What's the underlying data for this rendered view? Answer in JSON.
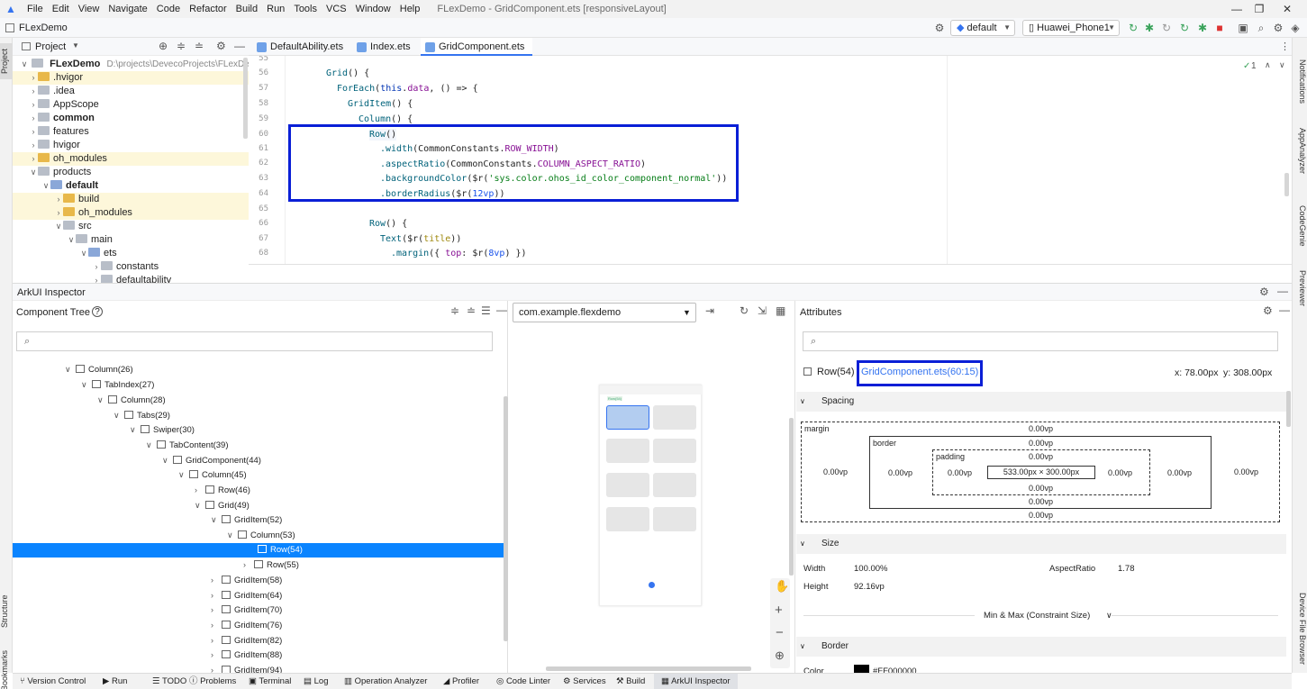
{
  "window": {
    "title": "FLexDemo - GridComponent.ets [responsiveLayout]",
    "menu": [
      "File",
      "Edit",
      "View",
      "Navigate",
      "Code",
      "Refactor",
      "Build",
      "Run",
      "Tools",
      "VCS",
      "Window",
      "Help"
    ]
  },
  "toolbar": {
    "project_name": "FLexDemo",
    "config": "default",
    "device": "Huawei_Phone1"
  },
  "left_strip": {
    "project_tab": "Project",
    "structure_tab": "Structure",
    "bookmarks_tab": "Bookmarks"
  },
  "right_strip": {
    "notifications": "Notifications",
    "app_analyzer": "AppAnalyzer",
    "code_genie": "CodeGenie",
    "previewer": "Previewer",
    "device_file_browser": "Device File Browser"
  },
  "project_panel": {
    "title": "Project",
    "root": "FLexDemo",
    "root_path": "D:\\projects\\DevecoProjects\\FLexDemo",
    "items": [
      ".hvigor",
      ".idea",
      "AppScope",
      "common",
      "features",
      "hvigor",
      "oh_modules",
      "products",
      "default",
      "build",
      "oh_modules",
      "src",
      "main",
      "ets",
      "constants",
      "defaultability"
    ]
  },
  "editor": {
    "tabs": [
      "DefaultAbility.ets",
      "Index.ets",
      "GridComponent.ets"
    ],
    "inspection_count": "1",
    "line_numbers": [
      "55",
      "56",
      "57",
      "58",
      "59",
      "60",
      "61",
      "62",
      "63",
      "64",
      "65",
      "66",
      "67",
      "68"
    ],
    "lines": {
      "l56_kw": "Grid",
      "l56_rest": "() {",
      "l57_kw": "ForEach",
      "l57_a": "(",
      "l57_this": "this",
      "l57_b": ".",
      "l57_data": "data",
      "l57_c": ", () => {",
      "l58_kw": "GridItem",
      "l58_rest": "() {",
      "l59_kw": "Column",
      "l59_rest": "() {",
      "l60_kw": "Row",
      "l60_rest": "()",
      "l61_fn": ".width",
      "l61_a": "(CommonConstants.",
      "l61_c": "ROW_WIDTH",
      "l61_b": ")",
      "l62_fn": ".aspectRatio",
      "l62_a": "(CommonConstants.",
      "l62_c": "COLUMN_ASPECT_RATIO",
      "l62_b": ")",
      "l63_fn": ".backgroundColor",
      "l63_a": "($r(",
      "l63_s": "'sys.color.ohos_id_color_component_normal'",
      "l63_b": "))",
      "l64_fn": ".borderRadius",
      "l64_a": "($r(",
      "l64_n": "12vp",
      "l64_b": "))",
      "l66_kw": "Row",
      "l66_rest": "() {",
      "l67_kw": "Text",
      "l67_a": "($r(",
      "l67_t": "title",
      "l67_b": "))",
      "l68_fn": ".margin",
      "l68_a": "({ ",
      "l68_k": "top",
      "l68_b": ": $r(",
      "l68_n": "8vp",
      "l68_c": ") })"
    }
  },
  "inspector": {
    "title": "ArkUI Inspector",
    "component_tree_title": "Component Tree",
    "app_select": "com.example.flexdemo",
    "tree": [
      {
        "label": "Column(26)",
        "open": true
      },
      {
        "label": "TabIndex(27)",
        "open": true
      },
      {
        "label": "Column(28)",
        "open": true
      },
      {
        "label": "Tabs(29)",
        "open": true
      },
      {
        "label": "Swiper(30)",
        "open": true
      },
      {
        "label": "TabContent(39)",
        "open": true
      },
      {
        "label": "GridComponent(44)",
        "open": true
      },
      {
        "label": "Column(45)",
        "open": true
      },
      {
        "label": "Row(46)",
        "open": false
      },
      {
        "label": "Grid(49)",
        "open": true
      },
      {
        "label": "GridItem(52)",
        "open": true
      },
      {
        "label": "Column(53)",
        "open": true
      },
      {
        "label": "Row(54)",
        "open": false
      },
      {
        "label": "Row(55)",
        "open": false
      },
      {
        "label": "GridItem(58)",
        "open": false
      },
      {
        "label": "GridItem(64)",
        "open": false
      },
      {
        "label": "GridItem(70)",
        "open": false
      },
      {
        "label": "GridItem(76)",
        "open": false
      },
      {
        "label": "GridItem(82)",
        "open": false
      },
      {
        "label": "GridItem(88)",
        "open": false
      },
      {
        "label": "GridItem(94)",
        "open": false
      }
    ],
    "preview_row_label": "Row(54)",
    "attributes": {
      "title": "Attributes",
      "selected_name": "Row(54)",
      "source_link": "GridComponent.ets(60:15)",
      "x": "x: 78.00px",
      "y": "y: 308.00px",
      "spacing_title": "Spacing",
      "margin_label": "margin",
      "border_label": "border",
      "padding_label": "padding",
      "margin_top": "0.00vp",
      "margin_left": "0.00vp",
      "margin_right": "0.00vp",
      "margin_bottom": "0.00vp",
      "border_top": "0.00vp",
      "border_left": "0.00vp",
      "border_right": "0.00vp",
      "border_bottom": "0.00vp",
      "padding_top": "0.00vp",
      "padding_left": "0.00vp",
      "padding_right": "0.00vp",
      "padding_bottom": "0.00vp",
      "content_size": "533.00px × 300.00px",
      "size_title": "Size",
      "width_label": "Width",
      "width_value": "100.00%",
      "aspect_label": "AspectRatio",
      "aspect_value": "1.78",
      "height_label": "Height",
      "height_value": "92.16vp",
      "minmax_label": "Min & Max (Constraint Size)",
      "border_title": "Border",
      "color_label": "Color",
      "color_value": "#FF000000"
    }
  },
  "bottom_bar": [
    "Version Control",
    "Run",
    "TODO",
    "Problems",
    "Terminal",
    "Log",
    "Operation Analyzer",
    "Profiler",
    "Code Linter",
    "Services",
    "Build",
    "ArkUI Inspector"
  ],
  "colors": {
    "accent": "#3574f0",
    "selection": "#0a84ff",
    "highlight_box": "#0a1fd6",
    "folder": "#e8b84a"
  }
}
